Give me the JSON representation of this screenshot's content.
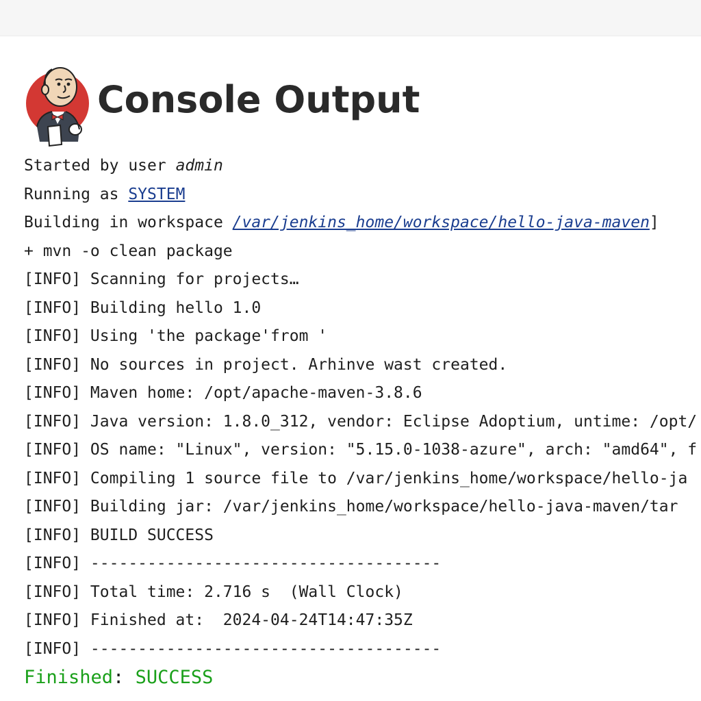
{
  "header": {
    "title": "Console Output",
    "logo_icon": "jenkins-butler-icon"
  },
  "console": {
    "started_prefix": "Started by user ",
    "started_user": "admin",
    "running_prefix": "Running as ",
    "running_user": "SYSTEM",
    "workspace_prefix": "Building in workspace ",
    "workspace_path": "/var/jenkins_home/workspace/hello-java-maven",
    "workspace_suffix": "]",
    "lines": [
      "+ mvn -o clean package",
      "[INFO] Scanning for projects…",
      "[INFO] Building hello 1.0",
      "[INFO] Using 'the package'from '",
      "[INFO] No sources in project. Arhinve wast created.",
      "[INFO] Maven home: /opt/apache-maven-3.8.6",
      "[INFO] Java version: 1.8.0_312, vendor: Eclipse Adoptium, untime: /opt/",
      "[INFO] OS name: \"Linux\", version: \"5.15.0-1038-azure\", arch: \"amd64\", f",
      "[INFO] Compiling 1 source file to /var/jenkins_home/workspace/hello-ja",
      "[INFO] Building jar: /var/jenkins_home/workspace/hello-java-maven/tar",
      "[INFO] BUILD SUCCESS",
      "[INFO] -------------------------------------",
      "[INFO] Total time: 2.716 s  (Wall Clock)",
      "[INFO] Finished at:  2024-04-24T14:47:35Z",
      "[INFO] -------------------------------------"
    ],
    "finished_label": "Finished",
    "finished_sep": ": ",
    "finished_status": "SUCCESS"
  },
  "colors": {
    "link": "#1a3d8f",
    "success": "#1aa01a",
    "title": "#2a2a2a"
  }
}
